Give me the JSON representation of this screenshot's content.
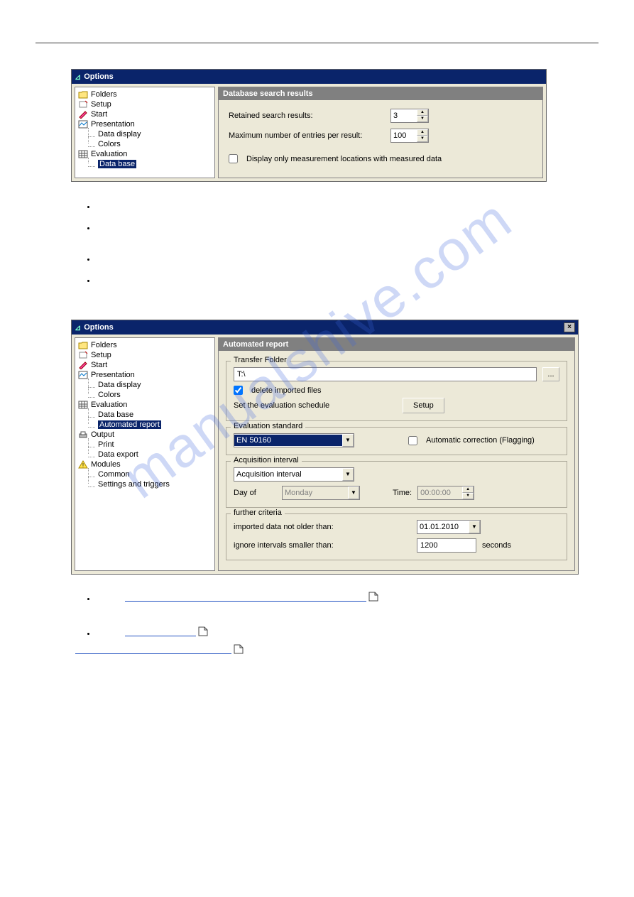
{
  "watermark": "manualshive.com",
  "win1": {
    "title": "Options",
    "tree": {
      "folders": "Folders",
      "setup": "Setup",
      "start": "Start",
      "presentation": "Presentation",
      "data_display": "Data display",
      "colors": "Colors",
      "evaluation": "Evaluation",
      "data_base": "Data base"
    },
    "panel_title": "Database search results",
    "lbl_retained": "Retained search results:",
    "val_retained": "3",
    "lbl_maxentries": "Maximum number of entries per result:",
    "val_maxentries": "100",
    "cb_display_only": "Display only measurement locations with measured data"
  },
  "win2": {
    "title": "Options",
    "tree": {
      "folders": "Folders",
      "setup": "Setup",
      "start": "Start",
      "presentation": "Presentation",
      "data_display": "Data display",
      "colors": "Colors",
      "evaluation": "Evaluation",
      "data_base": "Data base",
      "automated_report": "Automated report",
      "output": "Output",
      "print": "Print",
      "data_export": "Data export",
      "modules": "Modules",
      "common": "Common",
      "settings_triggers": "Settings and triggers"
    },
    "panel_title": "Automated report",
    "grp_transfer": "Transfer Folder",
    "val_transfer": "T:\\",
    "cb_delete": "delete imported files",
    "lbl_schedule": "Set the evaluation schedule",
    "btn_setup": "Setup",
    "grp_eval": "Evaluation standard",
    "val_eval_std": "EN 50160",
    "cb_flagging": "Automatic correction (Flagging)",
    "grp_acq": "Acquisition interval",
    "val_acq": "Acquisition interval",
    "lbl_day": "Day of",
    "val_day": "Monday",
    "lbl_time": "Time:",
    "val_time": "00:00:00",
    "grp_further": "further criteria",
    "lbl_older": "imported data not older than:",
    "val_date": "01.01.2010",
    "lbl_ignore": "ignore intervals smaller than:",
    "val_ignore": "1200",
    "lbl_seconds": "seconds"
  }
}
